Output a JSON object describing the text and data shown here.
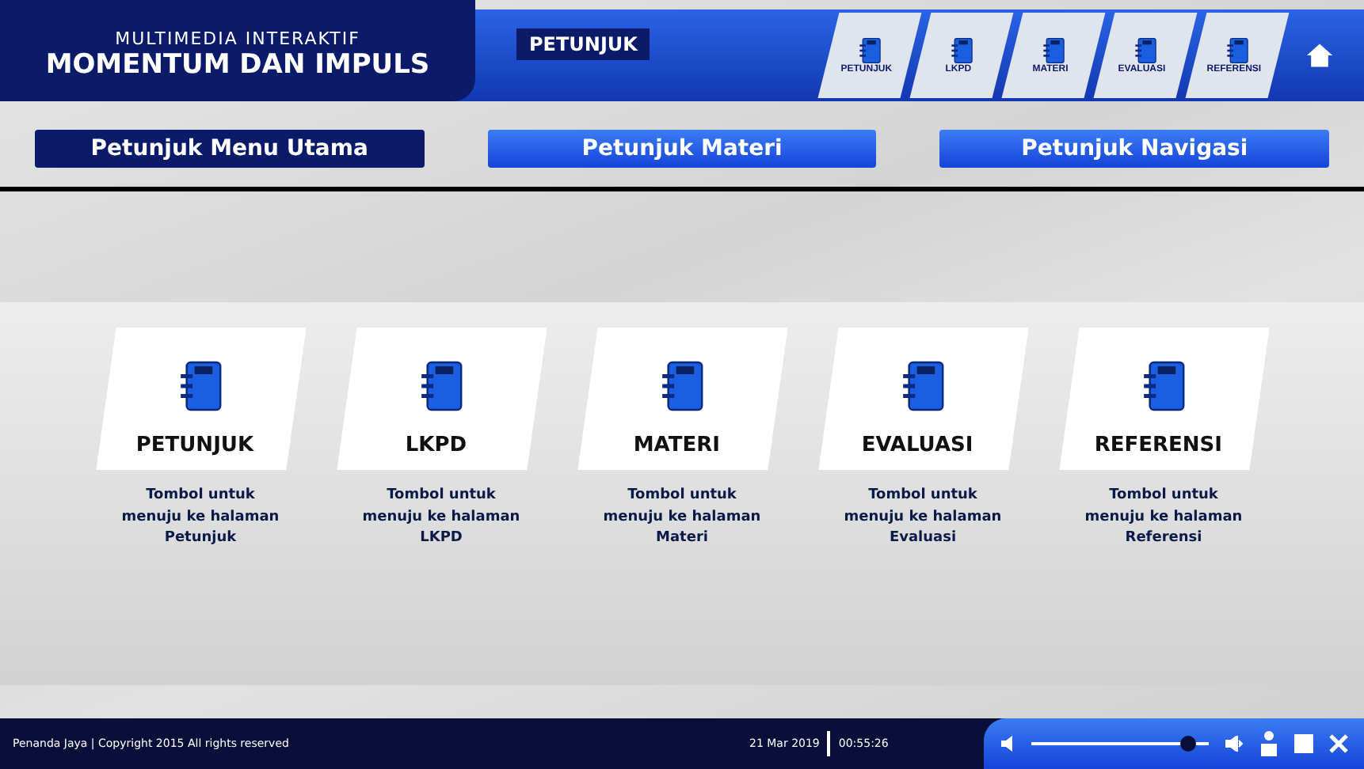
{
  "header": {
    "subtitle": "MULTIMEDIA INTERAKTIF",
    "title": "MOMENTUM DAN IMPULS",
    "section": "PETUNJUK",
    "nav": [
      {
        "label": "PETUNJUK",
        "kind": "book"
      },
      {
        "label": "LKPD",
        "kind": "book"
      },
      {
        "label": "MATERI",
        "kind": "book"
      },
      {
        "label": "EVALUASI",
        "kind": "book"
      },
      {
        "label": "REFERENSI",
        "kind": "book"
      },
      {
        "kind": "home"
      }
    ]
  },
  "tabs": [
    {
      "label": "Petunjuk Menu Utama",
      "selected": true
    },
    {
      "label": "Petunjuk Materi",
      "selected": false
    },
    {
      "label": "Petunjuk Navigasi",
      "selected": false
    }
  ],
  "cards": [
    {
      "title": "PETUNJUK",
      "description": "Tombol untuk menuju ke halaman Petunjuk"
    },
    {
      "title": "LKPD",
      "description": "Tombol untuk menuju ke halaman LKPD"
    },
    {
      "title": "MATERI",
      "description": "Tombol untuk menuju ke halaman Materi"
    },
    {
      "title": "EVALUASI",
      "description": "Tombol untuk menuju ke halaman Evaluasi"
    },
    {
      "title": "REFERENSI",
      "description": "Tombol untuk menuju ke halaman Referensi"
    }
  ],
  "footer": {
    "credit": "Penanda Jaya | Copyright 2015 All rights reserved",
    "date": "21 Mar 2019",
    "time": "00:55:26",
    "volume": {
      "level": 0.88
    }
  }
}
